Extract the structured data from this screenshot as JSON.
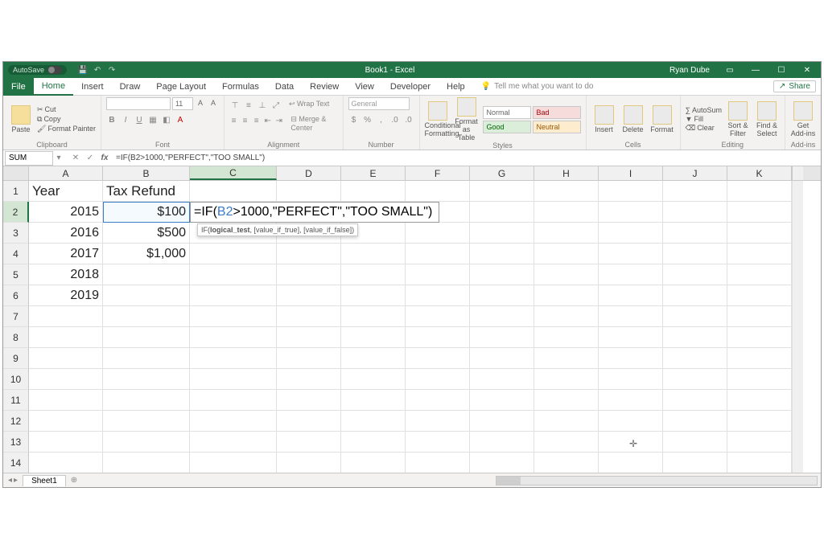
{
  "titlebar": {
    "autosave": "AutoSave",
    "title": "Book1 - Excel",
    "user": "Ryan Dube"
  },
  "tabs": {
    "file": "File",
    "home": "Home",
    "insert": "Insert",
    "draw": "Draw",
    "page_layout": "Page Layout",
    "formulas": "Formulas",
    "data": "Data",
    "review": "Review",
    "view": "View",
    "developer": "Developer",
    "help": "Help",
    "tell_me": "Tell me what you want to do",
    "share": "Share"
  },
  "ribbon": {
    "clipboard": {
      "paste": "Paste",
      "cut": "Cut",
      "copy": "Copy",
      "painter": "Format Painter",
      "label": "Clipboard"
    },
    "font": {
      "size": "11",
      "label": "Font"
    },
    "alignment": {
      "wrap": "Wrap Text",
      "merge": "Merge & Center",
      "label": "Alignment"
    },
    "number": {
      "general": "General",
      "label": "Number"
    },
    "styles": {
      "cond": "Conditional Formatting",
      "fmt": "Format as Table",
      "normal": "Normal",
      "bad": "Bad",
      "good": "Good",
      "neutral": "Neutral",
      "label": "Styles"
    },
    "cells": {
      "insert": "Insert",
      "delete": "Delete",
      "format": "Format",
      "label": "Cells"
    },
    "editing": {
      "sum": "AutoSum",
      "fill": "Fill",
      "clear": "Clear",
      "sort": "Sort & Filter",
      "find": "Find & Select",
      "label": "Editing"
    },
    "addins": {
      "get": "Get Add-ins",
      "label": "Add-ins"
    }
  },
  "namebox": "SUM",
  "formula_bar": "=IF(B2>1000,\"PERFECT\",\"TOO SMALL\")",
  "columns": [
    "A",
    "B",
    "C",
    "D",
    "E",
    "F",
    "G",
    "H",
    "I",
    "J",
    "K"
  ],
  "rows": [
    "1",
    "2",
    "3",
    "4",
    "5",
    "6",
    "7",
    "8",
    "9",
    "10",
    "11",
    "12",
    "13",
    "14"
  ],
  "data": {
    "A1": "Year",
    "B1": "Tax Refund",
    "A2": "2015",
    "B2": "$100",
    "A3": "2016",
    "B3": "$500",
    "A4": "2017",
    "B4": "$1,000",
    "A5": "2018",
    "A6": "2019"
  },
  "editing_cell": {
    "prefix": "=IF(",
    "ref": "B2",
    "suffix": ">1000,\"PERFECT\",\"TOO SMALL\")"
  },
  "tooltip": {
    "fn": "IF(",
    "bold": "logical_test",
    "rest": ", [value_if_true], [value_if_false])"
  },
  "sheet_tab": "Sheet1"
}
